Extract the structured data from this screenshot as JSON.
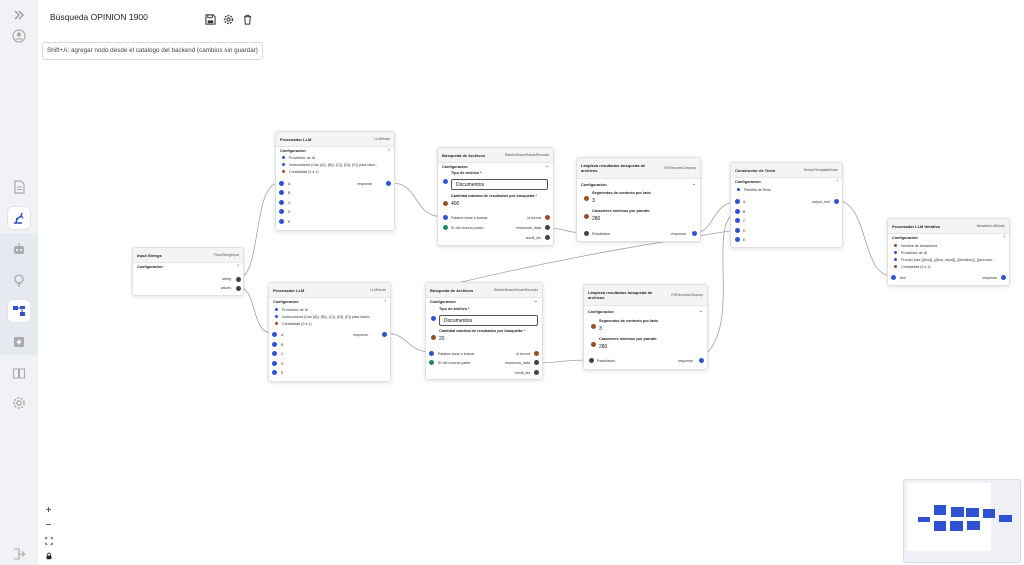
{
  "app": {
    "title": "Búsqueda OPINION 1900",
    "hint": "Shift+A: agregar nodo desde el catalogo del backend (cambios sin guardar)"
  },
  "toolbar": {
    "icons": [
      "save-icon",
      "gear-icon",
      "trash-icon"
    ]
  },
  "sidebar": {
    "items": [
      "expand-icon",
      "user-icon",
      "document-icon",
      "robot-arm-icon",
      "bot-icon",
      "bulb-icon",
      "workflow-icon",
      "plus-box-icon",
      "book-icon",
      "settings-icon",
      "logout-icon"
    ],
    "selected": [
      "robot-arm-icon",
      "workflow-icon"
    ]
  },
  "controls": {
    "zoom_in": "+",
    "zoom_out": "−",
    "fit": "fit-view-icon",
    "lock": "lock-icon"
  },
  "nodes": {
    "llm1": {
      "title": "Procesador LLM",
      "type": "LLMNode",
      "section": "Configuracion",
      "params": [
        "Proveedor de IA",
        "Instrucciones (Use {A}), {B}), {C}), {D}), {E}) para hace...",
        "Creatividad (0 a 1)"
      ],
      "inputs": [
        "A",
        "B",
        "C",
        "D",
        "E"
      ],
      "output": "response"
    },
    "llm2": {
      "title": "Procesador LLM",
      "type": "LLMNode",
      "section": "Configuracion",
      "params": [
        "Proveedor de IA",
        "Instrucciones (Use {A}), {B}), {C}), {D}), {E}) para hacer...",
        "Creatividad (0 a 1)"
      ],
      "inputs": [
        "A",
        "B",
        "C",
        "D",
        "E"
      ],
      "output": "response"
    },
    "input_strings": {
      "title": "Input Strings",
      "type": "FlowStringInput",
      "section": "Configuracion",
      "outputs": [
        "string",
        "values"
      ]
    },
    "search1": {
      "title": "Búsqueda de Archivos",
      "type": "ElasticSearchNodeRecords",
      "section": "Configuracion",
      "tipo_label": "Tipo de archivo *",
      "tipo_value": "Documentos",
      "cant_label": "Cantidad máxima de resultados por búsqueda *",
      "cant_value": "400",
      "inputs": [
        "Palabra clave a buscar",
        "ID del recurso padre"
      ],
      "outputs": [
        "id record",
        "resources_data",
        "result_ids"
      ]
    },
    "search2": {
      "title": "Búsqueda de Archivos",
      "type": "ElasticSearchNodeRecords",
      "section": "Configuracion",
      "tipo_label": "Tipo de archivo *",
      "tipo_value": "Documentos",
      "cant_label": "Cantidad máxima de resultados por búsqueda *",
      "cant_value": "20",
      "inputs": [
        "Palabra clave a buscar",
        "ID del recurso padre"
      ],
      "outputs": [
        "id record",
        "resources_data",
        "result_ids"
      ]
    },
    "clean1": {
      "title": "Limpieza resultados búsqueda de archivos",
      "type": "ESRecordsCleanup",
      "section": "Configuracion",
      "seg_label": "Segmentos de contexto por lado",
      "seg_value": "3",
      "car_label": "Caracteres mínimos por parrafo",
      "car_value": "280",
      "input": "Resultados",
      "output": "response"
    },
    "clean2": {
      "title": "Limpieza resultados búsqueda de archivos",
      "type": "ESRecordsCleanup",
      "section": "Configuracion",
      "seg_label": "Segmentos de contexto por lado",
      "seg_value": "3",
      "car_label": "Caracteres mínimos por parrafo",
      "car_value": "280",
      "input": "Resultados",
      "output": "response"
    },
    "text_builder": {
      "title": "Constructor de Texto",
      "type": "SimpleTemplateNode",
      "section": "Configuracion",
      "params": [
        "Plantilla de Texto"
      ],
      "inputs": [
        "A",
        "B",
        "C",
        "D",
        "E"
      ],
      "output": "output_text"
    },
    "llm_iter": {
      "title": "Procesador LLM Iterativo",
      "type": "IterativeLLMNode",
      "section": "Configuracion",
      "params": [
        "Nombre de iteraciones",
        "Proveedor de IA",
        "Prompt (use {{text}}, {{flow_input}}, {{iteration}}, {{accumu...",
        "Creatividad (0 a 1)"
      ],
      "input": "text",
      "output": "response"
    }
  }
}
